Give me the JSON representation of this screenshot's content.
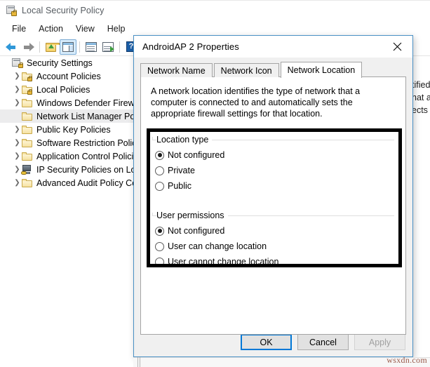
{
  "window": {
    "title": "Local Security Policy",
    "title_icon": "console-lock-icon",
    "menu": [
      "File",
      "Action",
      "View",
      "Help"
    ],
    "toolbar": [
      {
        "name": "back-button",
        "icon": "back-arrow-icon"
      },
      {
        "name": "forward-button",
        "icon": "forward-arrow-icon"
      },
      {
        "name": "up-one-level-button",
        "icon": "folder-up-icon"
      },
      {
        "name": "show-hide-tree-button",
        "icon": "console-tree-icon"
      },
      {
        "name": "properties-button",
        "icon": "properties-window-icon"
      },
      {
        "name": "export-list-button",
        "icon": "export-list-icon"
      },
      {
        "name": "help-button",
        "icon": "help-question-icon"
      }
    ]
  },
  "tree": {
    "root": {
      "label": "Security Settings",
      "icon": "security-settings-icon"
    },
    "items": [
      {
        "label": "Account Policies",
        "icon": "folder-lock-icon",
        "expandable": true,
        "selected": false
      },
      {
        "label": "Local Policies",
        "icon": "folder-lock-icon",
        "expandable": true,
        "selected": false
      },
      {
        "label": "Windows Defender Firewall",
        "icon": "folder-icon",
        "expandable": true,
        "selected": false
      },
      {
        "label": "Network List Manager Policies",
        "icon": "folder-icon",
        "expandable": false,
        "selected": true
      },
      {
        "label": "Public Key Policies",
        "icon": "folder-icon",
        "expandable": true,
        "selected": false
      },
      {
        "label": "Software Restriction Policies",
        "icon": "folder-icon",
        "expandable": true,
        "selected": false
      },
      {
        "label": "Application Control Policies",
        "icon": "folder-icon",
        "expandable": true,
        "selected": false
      },
      {
        "label": "IP Security Policies on Local",
        "icon": "ip-security-icon",
        "expandable": true,
        "selected": false
      },
      {
        "label": "Advanced Audit Policy Configuration",
        "icon": "folder-icon",
        "expandable": true,
        "selected": false
      }
    ]
  },
  "result_pane": {
    "visible_lines": [
      "tified",
      "hat a",
      "ects t"
    ]
  },
  "dialog": {
    "title": "AndroidAP  2 Properties",
    "close_icon": "close-x-icon",
    "tabs": [
      {
        "label": "Network Name",
        "active": false
      },
      {
        "label": "Network Icon",
        "active": false
      },
      {
        "label": "Network Location",
        "active": true
      }
    ],
    "description": "A network location identifies the type of network that a computer is connected to and automatically sets the appropriate firewall settings for that location.",
    "groups": [
      {
        "legend": "Location type",
        "options": [
          {
            "label": "Not configured",
            "checked": true
          },
          {
            "label": "Private",
            "checked": false
          },
          {
            "label": "Public",
            "checked": false
          }
        ]
      },
      {
        "legend": "User permissions",
        "options": [
          {
            "label": "Not configured",
            "checked": true
          },
          {
            "label": "User can change location",
            "checked": false
          },
          {
            "label": "User cannot change location",
            "checked": false
          }
        ]
      }
    ],
    "buttons": [
      {
        "label": "OK",
        "state": "default"
      },
      {
        "label": "Cancel",
        "state": "normal"
      },
      {
        "label": "Apply",
        "state": "disabled"
      }
    ]
  },
  "watermark": "wsxdn.com",
  "colors": {
    "accent": "#0078d7",
    "dialog_border": "#4a90c4",
    "annotation": "#000000",
    "selection": "#ececed",
    "title_text": "#555b60"
  }
}
